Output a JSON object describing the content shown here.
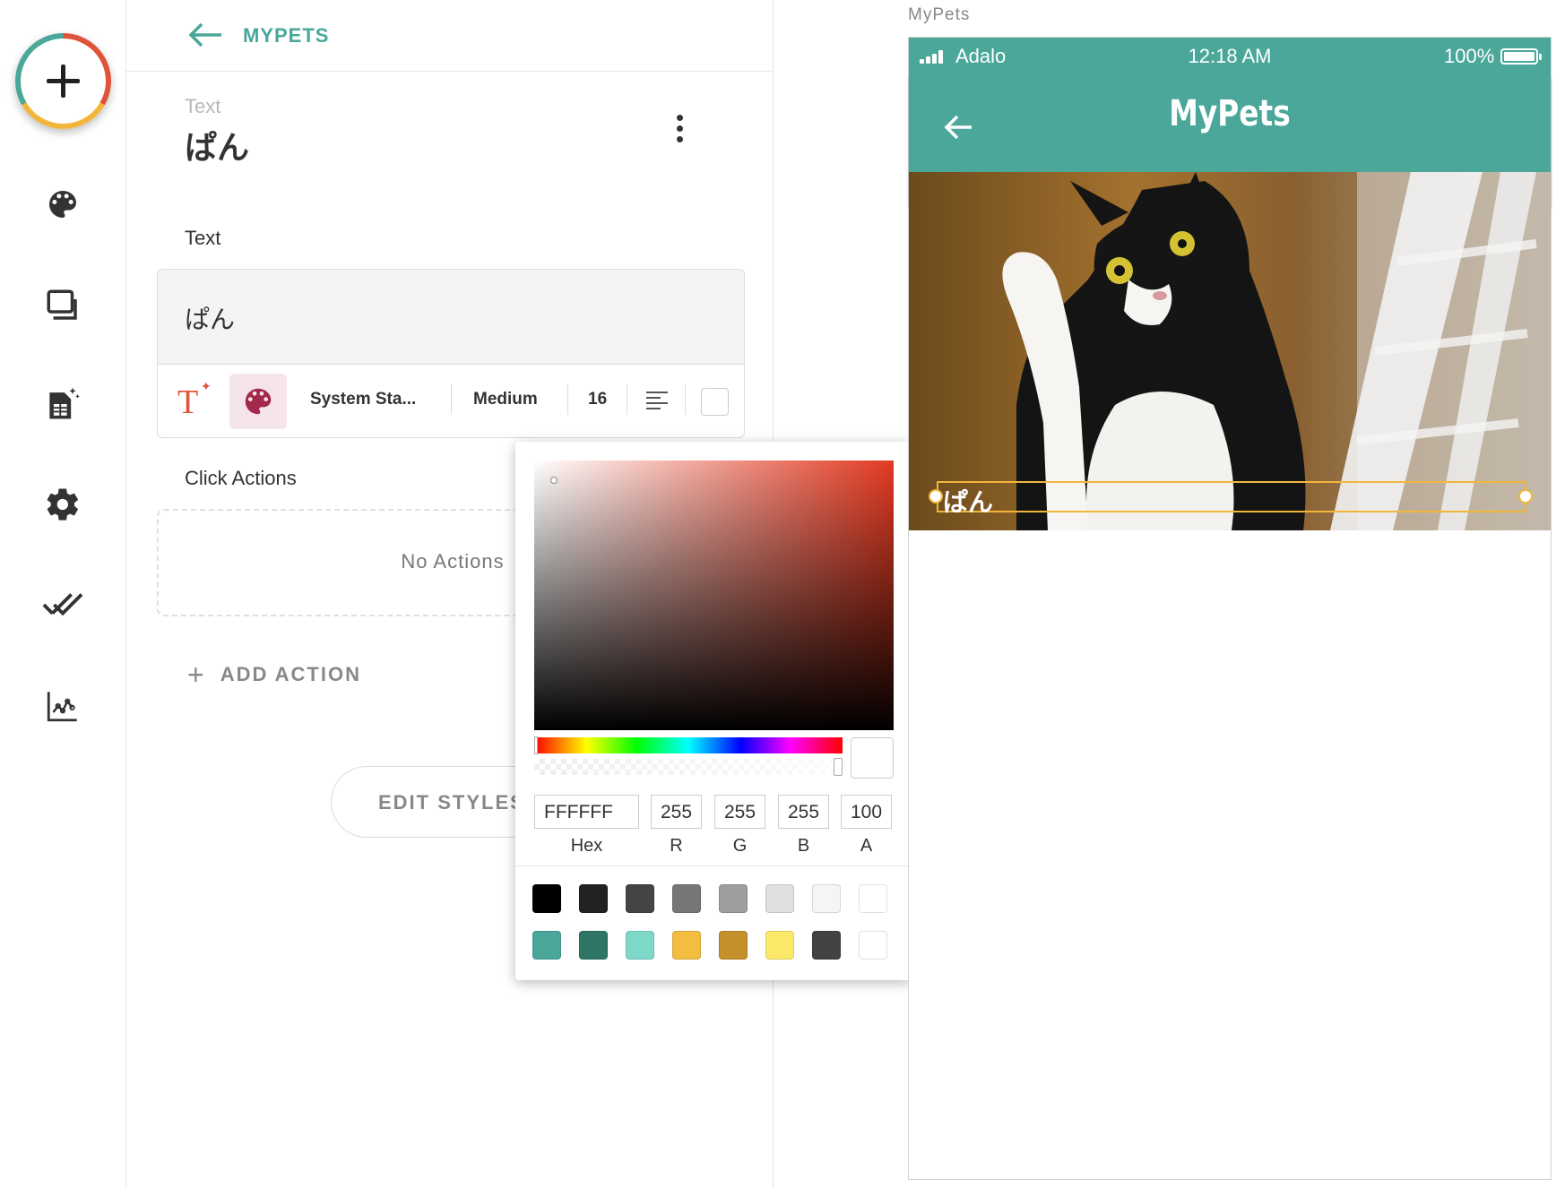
{
  "rail": {
    "items": [
      {
        "name": "add-component",
        "icon": "plus-icon"
      },
      {
        "name": "branding",
        "icon": "palette-icon"
      },
      {
        "name": "screens",
        "icon": "screens-icon"
      },
      {
        "name": "database",
        "icon": "database-icon"
      },
      {
        "name": "settings",
        "icon": "gear-icon"
      },
      {
        "name": "publish",
        "icon": "double-check-icon"
      },
      {
        "name": "analytics",
        "icon": "analytics-icon"
      }
    ]
  },
  "panel": {
    "back_label": "MYPETS",
    "component_type": "Text",
    "component_name": "ぱん",
    "text_section_label": "Text",
    "text_value": "ぱん",
    "format": {
      "font": "System Sta...",
      "weight": "Medium",
      "size": "16",
      "align_icon": "align-left-icon",
      "color": "#FFFFFF"
    },
    "click_actions_label": "Click Actions",
    "no_actions": "No Actions",
    "add_action": "ADD ACTION",
    "edit_styles": "EDIT STYLES"
  },
  "picker": {
    "hex": "FFFFFF",
    "r": "255",
    "g": "255",
    "b": "255",
    "a": "100",
    "labels": {
      "hex": "Hex",
      "r": "R",
      "g": "G",
      "b": "B",
      "a": "A"
    },
    "hue_color": "#E23A22",
    "swatches": [
      "#000000",
      "#222222",
      "#444444",
      "#777777",
      "#9E9E9E",
      "#E0E0E0",
      "#F5F5F5",
      "#FFFFFF",
      "#4AA79A",
      "#2E7566",
      "#7DD8CA",
      "#F2BD40",
      "#C4902B",
      "#FCE96A",
      "#424242",
      "#FFFFFF"
    ]
  },
  "preview": {
    "title": "MyPets",
    "status": {
      "carrier": "Adalo",
      "time": "12:18 AM",
      "battery": "100%"
    },
    "nav_title": "MyPets",
    "overlay_text": "ぱん",
    "theme_color": "#4AA79A"
  }
}
